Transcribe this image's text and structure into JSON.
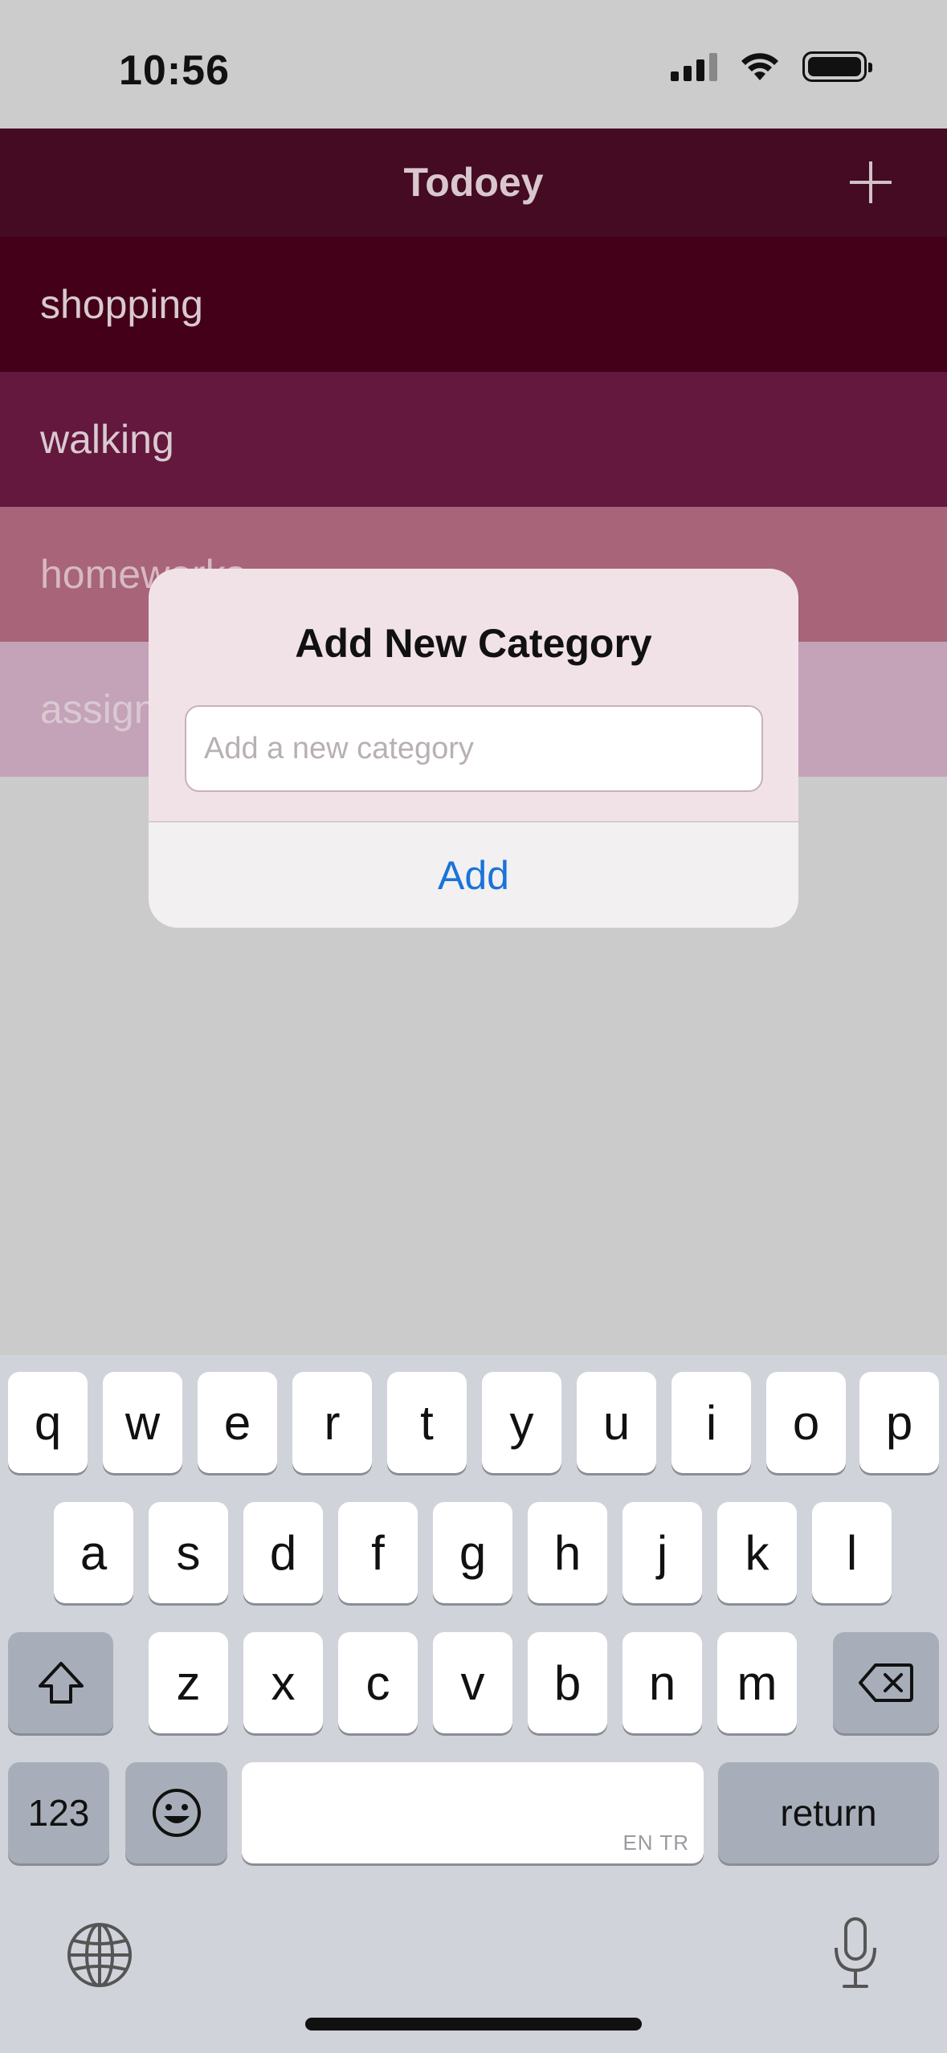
{
  "status_bar": {
    "time": "10:56",
    "icons": [
      "signal-icon",
      "wifi-icon",
      "battery-icon"
    ]
  },
  "nav": {
    "title": "Todoey",
    "add_icon": "plus-icon"
  },
  "categories": [
    {
      "name": "shopping",
      "color": "#440018"
    },
    {
      "name": "walking",
      "color": "#64183d"
    },
    {
      "name": "homeworks",
      "color": "#a86479"
    },
    {
      "name": "assignments",
      "color": "#c4a2b8"
    }
  ],
  "alert": {
    "title": "Add New Category",
    "input_placeholder": "Add a new category",
    "input_value": "",
    "action_label": "Add",
    "action_color": "#1a73d9"
  },
  "keyboard": {
    "row1": [
      "q",
      "w",
      "e",
      "r",
      "t",
      "y",
      "u",
      "i",
      "o",
      "p"
    ],
    "row2": [
      "a",
      "s",
      "d",
      "f",
      "g",
      "h",
      "j",
      "k",
      "l"
    ],
    "row3": [
      "z",
      "x",
      "c",
      "v",
      "b",
      "n",
      "m"
    ],
    "shift_icon": "shift-icon",
    "delete_icon": "backspace-icon",
    "numbers_label": "123",
    "emoji_icon": "emoji-icon",
    "space_languages": "EN TR",
    "return_label": "return",
    "globe_icon": "globe-icon",
    "mic_icon": "microphone-icon"
  }
}
